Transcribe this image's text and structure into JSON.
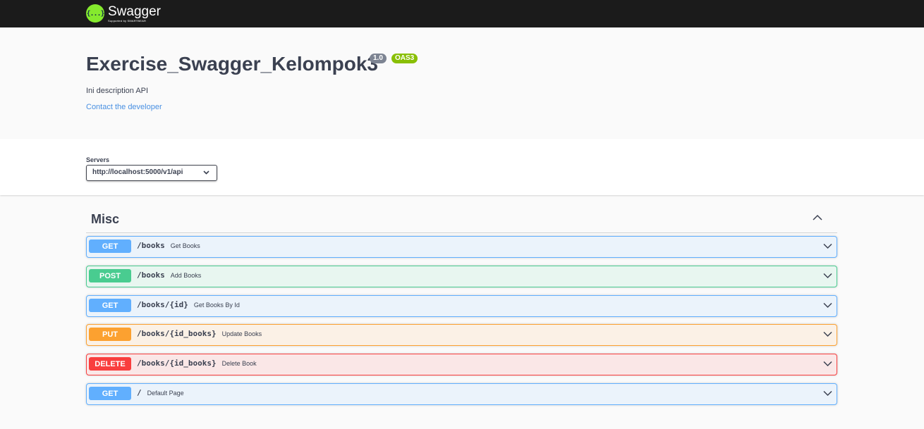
{
  "topbar": {
    "logo_mark": "{...}",
    "logo_name": "Swagger",
    "logo_sub": "Supported by SMARTBEAR"
  },
  "info": {
    "title": "Exercise_Swagger_Kelompok3",
    "version": "1.0",
    "oas": "OAS3",
    "description": "Ini description API",
    "contact": "Contact the developer"
  },
  "servers": {
    "label": "Servers",
    "selected": "http://localhost:5000/v1/api"
  },
  "section": {
    "title": "Misc",
    "icon": "chevron-up-icon"
  },
  "operations": [
    {
      "method": "GET",
      "path": "/books",
      "summary": "Get Books"
    },
    {
      "method": "POST",
      "path": "/books",
      "summary": "Add Books"
    },
    {
      "method": "GET",
      "path": "/books/{id}",
      "summary": "Get Books By Id"
    },
    {
      "method": "PUT",
      "path": "/books/{id_books}",
      "summary": "Update Books"
    },
    {
      "method": "DELETE",
      "path": "/books/{id_books}",
      "summary": "Delete Book"
    },
    {
      "method": "GET",
      "path": "/",
      "summary": "Default Page"
    }
  ],
  "colors": {
    "topbar": "#1b1b1b",
    "get": "#61affe",
    "post": "#49cc90",
    "put": "#fca130",
    "delete": "#f93e3e",
    "logo": "#85ea2d"
  }
}
